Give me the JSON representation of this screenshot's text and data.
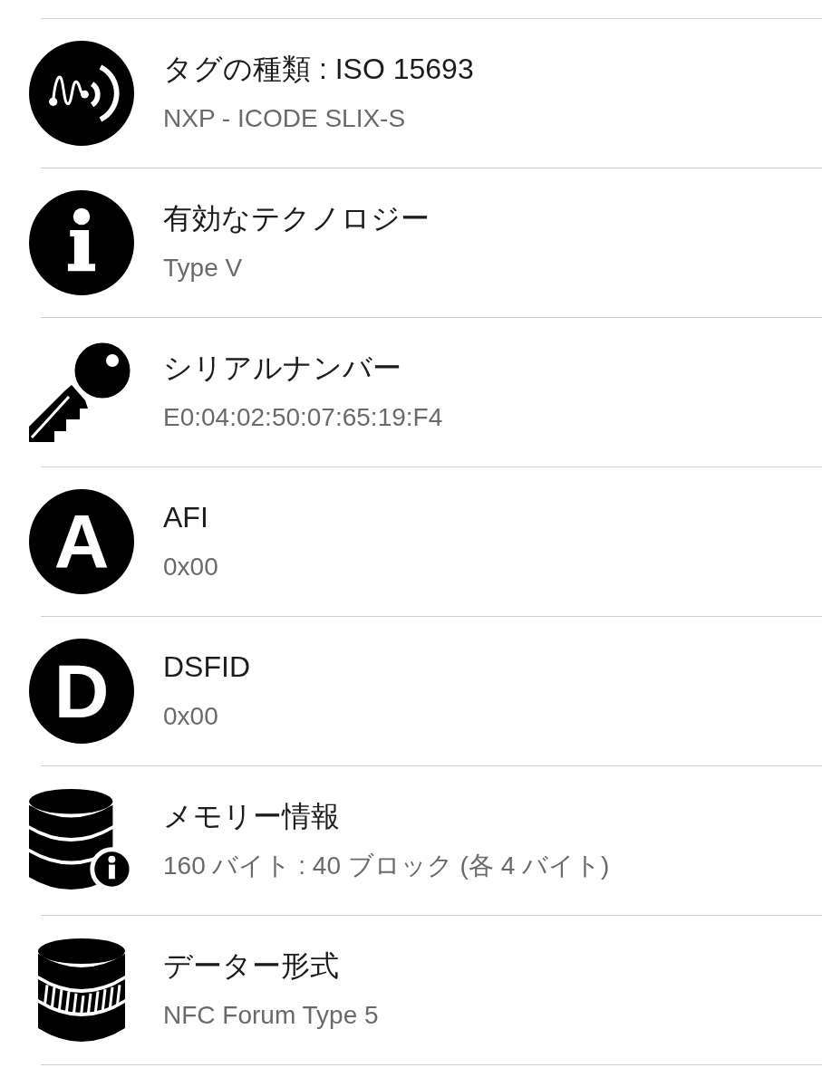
{
  "rows": [
    {
      "kind": "signal",
      "title": "タグの種類 : ISO 15693",
      "value": "NXP - ICODE SLIX-S"
    },
    {
      "kind": "info",
      "title": "有効なテクノロジー",
      "value": "Type V"
    },
    {
      "kind": "key",
      "title": "シリアルナンバー",
      "value": "E0:04:02:50:07:65:19:F4"
    },
    {
      "kind": "letter",
      "letter": "A",
      "title": "AFI",
      "value": "0x00"
    },
    {
      "kind": "letter",
      "letter": "D",
      "title": "DSFID",
      "value": "0x00"
    },
    {
      "kind": "database-info",
      "title": "メモリー情報",
      "value": "160 バイト : 40 ブロック (各 4 バイト)"
    },
    {
      "kind": "database",
      "title": "データー形式",
      "value": "NFC Forum Type 5"
    }
  ]
}
